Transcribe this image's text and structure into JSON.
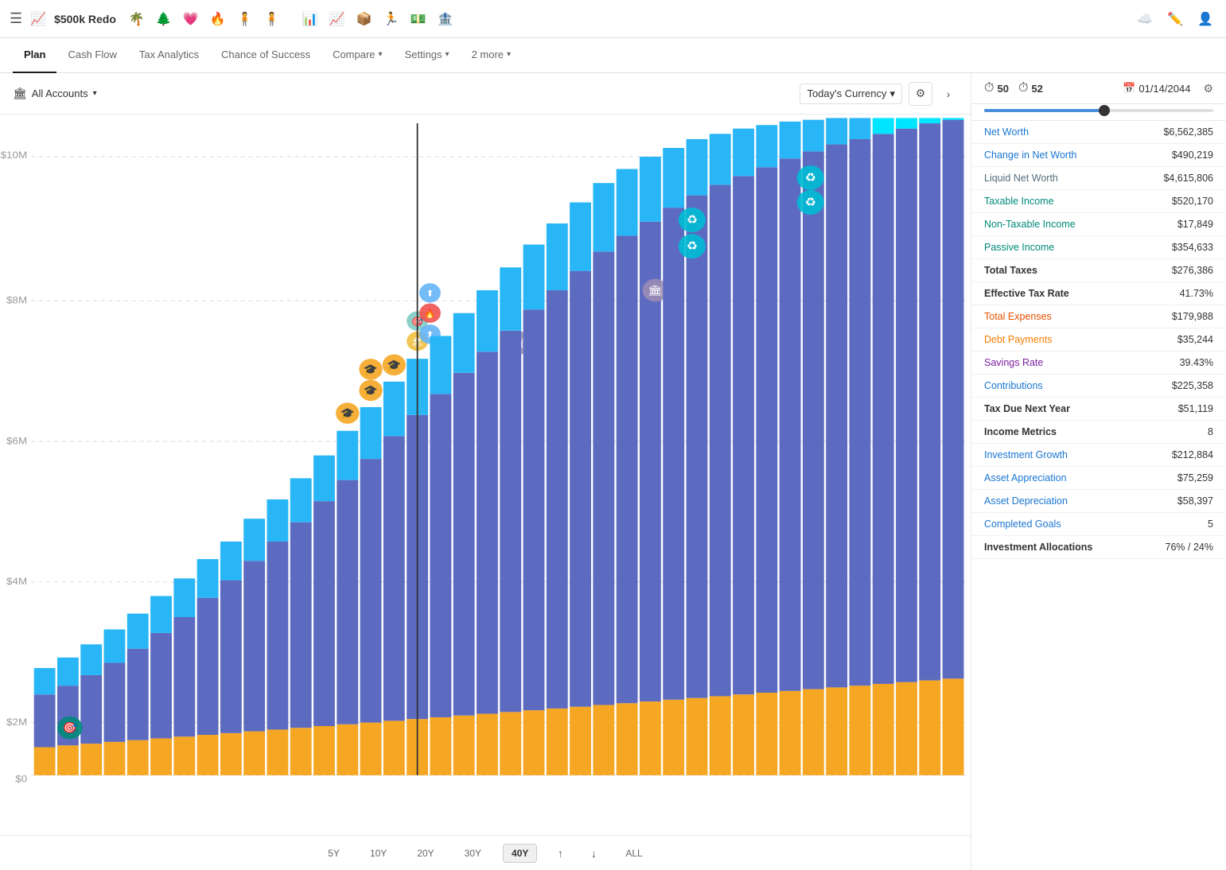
{
  "toolbar": {
    "hamburger": "☰",
    "app_title": "$500k Redo",
    "app_icon": "📈",
    "right_icons": [
      "☁",
      "✏",
      "👤"
    ]
  },
  "nav": {
    "tabs": [
      {
        "label": "Plan",
        "active": true,
        "has_chevron": false
      },
      {
        "label": "Cash Flow",
        "active": false,
        "has_chevron": false
      },
      {
        "label": "Tax Analytics",
        "active": false,
        "has_chevron": false
      },
      {
        "label": "Chance of Success",
        "active": false,
        "has_chevron": false
      },
      {
        "label": "Compare",
        "active": false,
        "has_chevron": true
      },
      {
        "label": "Settings",
        "active": false,
        "has_chevron": true
      },
      {
        "label": "2 more",
        "active": false,
        "has_chevron": true
      }
    ]
  },
  "chart_toolbar": {
    "accounts_label": "All Accounts",
    "accounts_icon": "🏛",
    "currency_label": "Today's Currency",
    "filter_icon": "⚙",
    "nav_icon": "›"
  },
  "chart_bottom": {
    "time_options": [
      "5Y",
      "10Y",
      "20Y",
      "30Y",
      "40Y",
      "ALL"
    ],
    "active": "40Y",
    "up_arrow": "↑",
    "down_arrow": "↓"
  },
  "right_panel": {
    "header": {
      "age1_icon": "⏱",
      "age1_value": "50",
      "age2_icon": "⏱",
      "age2_value": "52",
      "date_icon": "📅",
      "date_value": "01/14/2044",
      "gear_icon": "⚙"
    },
    "metrics": [
      {
        "label": "Net Worth",
        "value": "$6,562,385",
        "style": "blue-link"
      },
      {
        "label": "Change in Net Worth",
        "value": "$490,219",
        "style": "blue-link"
      },
      {
        "label": "Liquid Net Worth",
        "value": "$4,615,806",
        "style": "gray-link"
      },
      {
        "label": "Taxable Income",
        "value": "$520,170",
        "style": "teal-link"
      },
      {
        "label": "Non-Taxable Income",
        "value": "$17,849",
        "style": "teal-link"
      },
      {
        "label": "Passive Income",
        "value": "$354,633",
        "style": "teal-link"
      },
      {
        "label": "Total Taxes",
        "value": "$276,386",
        "style": "bold"
      },
      {
        "label": "Effective Tax Rate",
        "value": "41.73%",
        "style": "bold"
      },
      {
        "label": "Total Expenses",
        "value": "$179,988",
        "style": "orange-link"
      },
      {
        "label": "Debt Payments",
        "value": "$35,244",
        "style": "amber-link"
      },
      {
        "label": "Savings Rate",
        "value": "39.43%",
        "style": "purple-link"
      },
      {
        "label": "Contributions",
        "value": "$225,358",
        "style": "blue-link"
      },
      {
        "label": "Tax Due Next Year",
        "value": "$51,119",
        "style": "bold"
      },
      {
        "label": "Income Metrics",
        "value": "8",
        "style": "bold"
      },
      {
        "label": "Investment Growth",
        "value": "$212,884",
        "style": "blue-link"
      },
      {
        "label": "Asset Appreciation",
        "value": "$75,259",
        "style": "blue-link"
      },
      {
        "label": "Asset Depreciation",
        "value": "$58,397",
        "style": "blue-link"
      },
      {
        "label": "Completed Goals",
        "value": "5",
        "style": "blue-link"
      },
      {
        "label": "Investment Allocations",
        "value": "76% / 24%",
        "style": "bold"
      }
    ]
  },
  "chart": {
    "y_labels": [
      "$10M",
      "$8M",
      "$6M",
      "$4M",
      "$2M",
      "$0"
    ],
    "x_label_left": "$0"
  }
}
